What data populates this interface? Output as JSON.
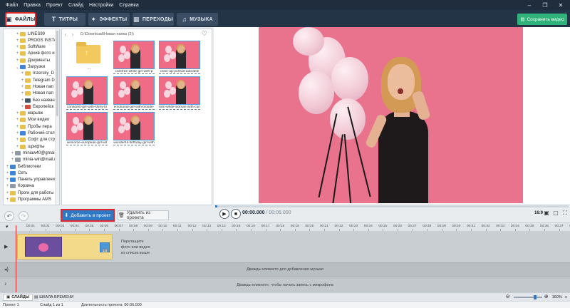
{
  "menu": [
    "Файл",
    "Правка",
    "Проект",
    "Слайд",
    "Настройки",
    "Справка"
  ],
  "window_controls": [
    "–",
    "❐",
    "✕"
  ],
  "tabs": [
    {
      "label": "ФАЙЛЫ",
      "icon": "files-icon",
      "active": true
    },
    {
      "label": "ТИТРЫ",
      "icon": "text-icon",
      "active": false
    },
    {
      "label": "ЭФФЕКТЫ",
      "icon": "effects-icon",
      "active": false
    },
    {
      "label": "ПЕРЕХОДЫ",
      "icon": "transitions-icon",
      "active": false
    },
    {
      "label": "МУЗЫКА",
      "icon": "music-icon",
      "active": false
    }
  ],
  "save_button": "Сохранить видео",
  "tree": [
    {
      "label": "LINES99",
      "icon": "folder"
    },
    {
      "label": "PROGS INSTAL",
      "icon": "folder"
    },
    {
      "label": "SoftWare",
      "icon": "folder"
    },
    {
      "label": "Архив фото и",
      "icon": "folder"
    },
    {
      "label": "Документы",
      "icon": "folder"
    },
    {
      "label": "Загрузки",
      "icon": "download"
    },
    {
      "label": "Inzersky_D",
      "icon": "folder"
    },
    {
      "label": "Telegram D",
      "icon": "folder"
    },
    {
      "label": "Новая пап",
      "icon": "folder"
    },
    {
      "label": "Новая пап",
      "icon": "folder"
    },
    {
      "label": "Без назван",
      "icon": "dark"
    },
    {
      "label": "Европейск",
      "icon": "red"
    },
    {
      "label": "марьяж",
      "icon": "folder"
    },
    {
      "label": "Мои видео",
      "icon": "folder"
    },
    {
      "label": "Пробы пера",
      "icon": "folder"
    },
    {
      "label": "Рабочий стол",
      "icon": "blue"
    },
    {
      "label": "Софт для стра",
      "icon": "folder"
    },
    {
      "label": "шрифты",
      "icon": "folder"
    },
    {
      "label": "miniaw40@gmail",
      "icon": "gray"
    },
    {
      "label": "minia-win@mail.r",
      "icon": "gray"
    },
    {
      "label": "Библиотеки",
      "icon": "blue"
    },
    {
      "label": "Сеть",
      "icon": "blue"
    },
    {
      "label": "Панель управления",
      "icon": "blue"
    },
    {
      "label": "Корзина",
      "icon": "gray"
    },
    {
      "label": "Проги для работы",
      "icon": "folder"
    },
    {
      "label": "Программы AMS",
      "icon": "folder"
    }
  ],
  "browser": {
    "path": "D:\\Download\\Новая папка (2)\\",
    "folder_up_label": "...",
    "files": [
      "carefree-white-girl-with-p",
      "close-up-portrait-adorable",
      "confident-girl-with-shiny-bl",
      "emotional-girl-with-blonde-",
      "slim-white-woman-with-curi",
      "winsome-european-girl-wit",
      "wonderful-birthday-girl-with"
    ]
  },
  "add_button": "Добавить в проект",
  "delete_button": "Удалить из проекта",
  "player": {
    "current": "00:00.000",
    "total": "/ 00:06.000",
    "ratio": "16:9"
  },
  "ruler_ticks": [
    "00:01",
    "00:02",
    "00:03",
    "00:04",
    "00:05",
    "00:06",
    "00:07",
    "00:08",
    "00:09",
    "00:10",
    "00:11",
    "00:12",
    "00:13",
    "00:14",
    "00:15",
    "00:16",
    "00:17",
    "00:18",
    "00:19",
    "00:20",
    "00:21",
    "00:22",
    "00:23",
    "00:24",
    "00:25",
    "00:26",
    "00:27",
    "00:28",
    "00:29",
    "00:30",
    "00:31",
    "00:32",
    "00:33",
    "00:34",
    "00:35",
    "00:36",
    "00:37",
    "00:38"
  ],
  "timeline": {
    "drop_hint_1": "Перетащите",
    "drop_hint_2": "фото или видео",
    "drop_hint_3": "из списка выше",
    "transition_duration": "1.5",
    "music_hint": "Дважды кликните для добавления музыки",
    "mic_hint": "Дважды кликните, чтобы начать запись с микрофона"
  },
  "modes": [
    "СЛАЙДЫ",
    "ШКАЛА ВРЕМЕНИ"
  ],
  "zoom": "160%",
  "status": {
    "project": "Проект 1",
    "slide": "Слайд 1 из 1",
    "duration": "Длительность проекта: 00:06.000"
  }
}
